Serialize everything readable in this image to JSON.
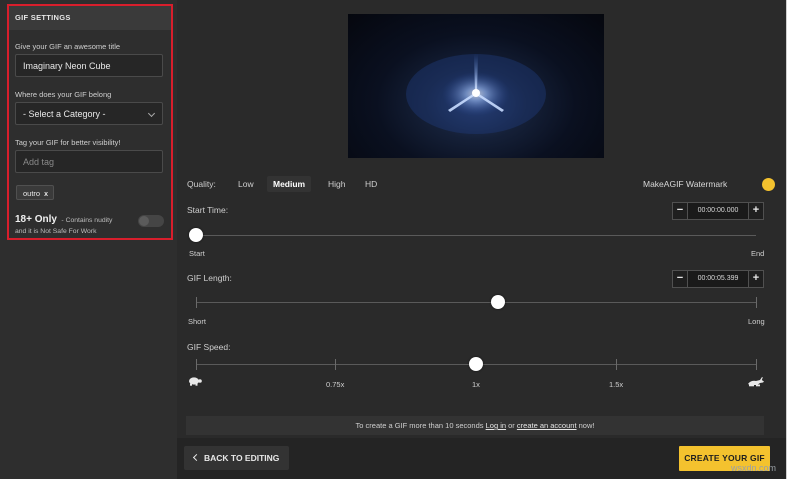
{
  "sidebar": {
    "header": "GIF SETTINGS",
    "title_label": "Give your GIF an awesome title",
    "title_value": "Imaginary Neon Cube",
    "category_label": "Where does your GIF belong",
    "category_value": "- Select a Category -",
    "tag_label": "Tag your GIF for better visibility!",
    "tag_placeholder": "Add tag",
    "tags": [
      {
        "label": "outro",
        "remove": "x"
      }
    ],
    "adult_title": "18+ Only",
    "adult_desc_1": "- Contains nudity",
    "adult_desc_2": "and it is Not Safe For Work",
    "adult_on": false
  },
  "quality": {
    "label": "Quality:",
    "options": [
      "Low",
      "Medium",
      "High",
      "HD"
    ],
    "selected": "Medium",
    "watermark_label": "MakeAGIF Watermark",
    "watermark_on": true
  },
  "start_time": {
    "label": "Start Time:",
    "value": "00:00:00.000",
    "minus": "−",
    "plus": "+",
    "left_label": "Start",
    "right_label": "End",
    "position": 0.0
  },
  "gif_length": {
    "label": "GIF Length:",
    "value": "00:00:05.399",
    "minus": "−",
    "plus": "+",
    "left_label": "Short",
    "right_label": "Long",
    "position": 0.54
  },
  "gif_speed": {
    "label": "GIF Speed:",
    "ticks": [
      "0.75x",
      "1x",
      "1.5x"
    ],
    "slow_icon": "turtle-icon",
    "fast_icon": "rabbit-icon",
    "position": 0.5
  },
  "info": {
    "prefix": "To create a GIF more than 10 seconds",
    "login": "Log in",
    "middle": "or",
    "signup": "create an account",
    "suffix": "now!"
  },
  "footer": {
    "back_label": "BACK TO EDITING",
    "create_label": "CREATE YOUR GIF"
  },
  "watermark": "wsxdn.com",
  "colors": {
    "accent": "#f4c22e",
    "highlight_border": "#d81e2c",
    "background": "#2a2a2a"
  }
}
